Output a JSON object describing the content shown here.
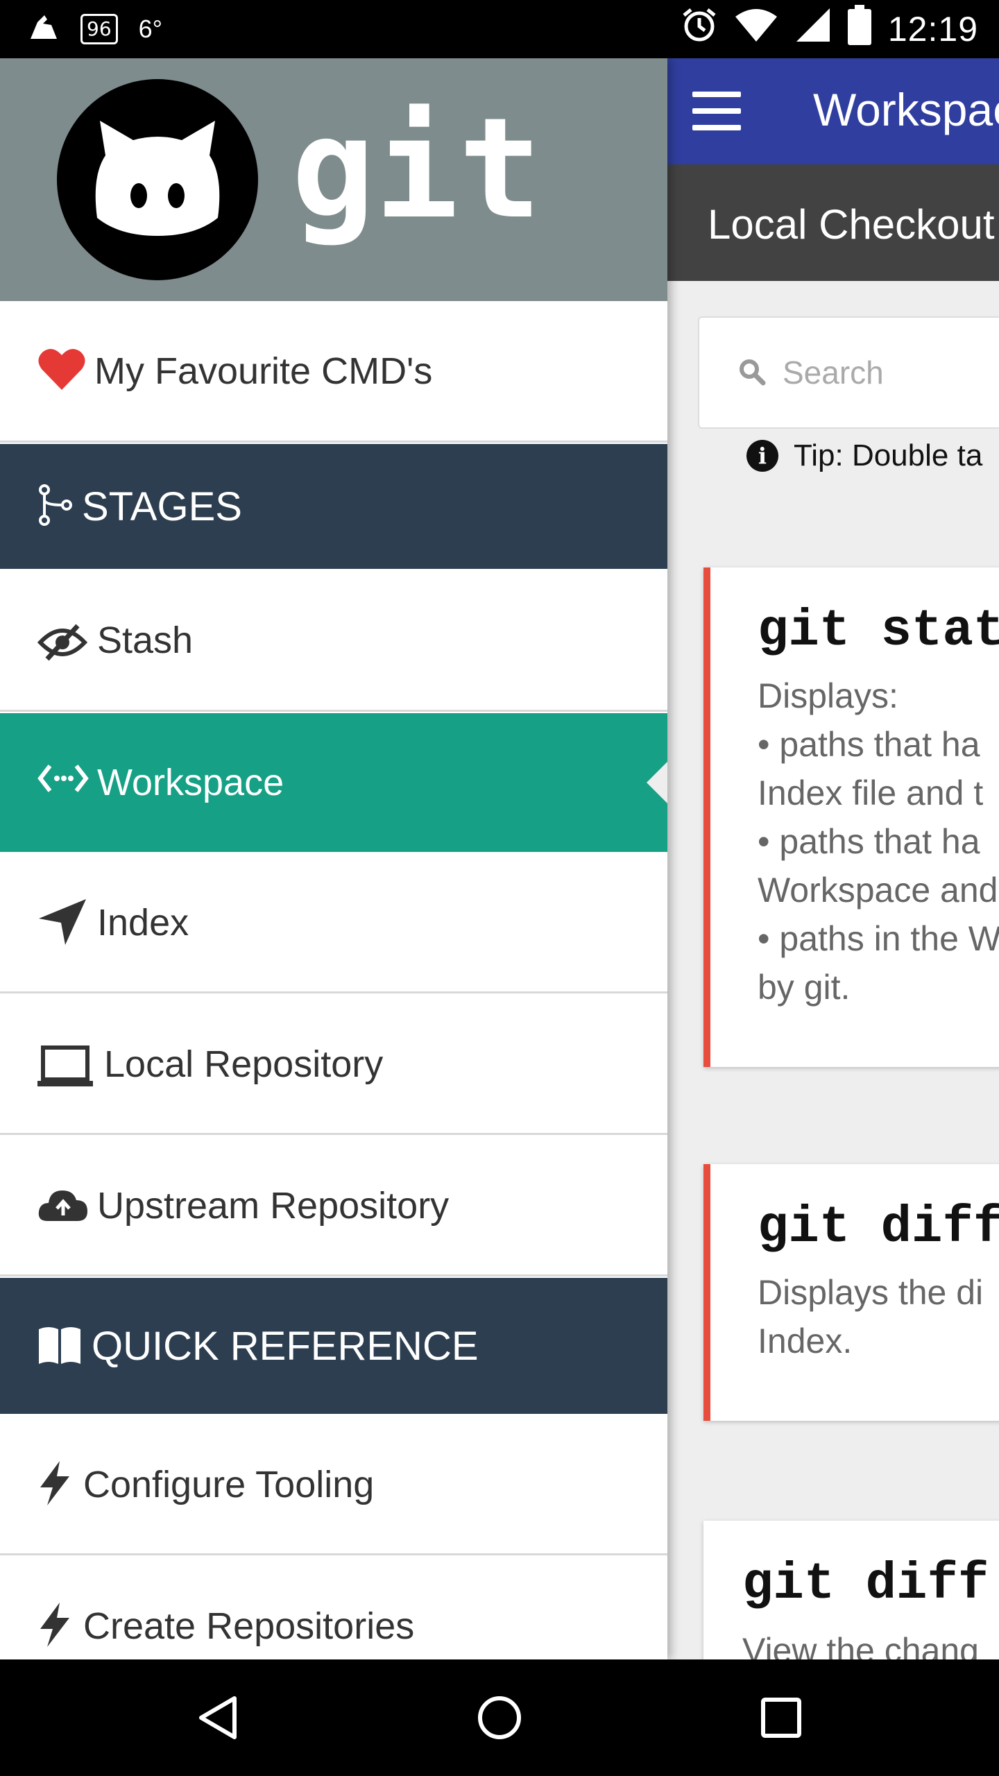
{
  "status_bar": {
    "badge": "96",
    "temperature": "6°",
    "battery_level": "96",
    "time": "12:19"
  },
  "header": {
    "logo_text": "git"
  },
  "drawer": {
    "favourites_label": "My Favourite CMD's",
    "stages_label": "STAGES",
    "items": [
      {
        "label": "Stash",
        "icon": "eye-slash-icon"
      },
      {
        "label": "Workspace",
        "icon": "code-arrows-icon",
        "active": true
      },
      {
        "label": "Index",
        "icon": "location-arrow-icon"
      },
      {
        "label": "Local Repository",
        "icon": "laptop-icon"
      },
      {
        "label": "Upstream Repository",
        "icon": "cloud-upload-icon"
      }
    ],
    "quick_reference_label": "QUICK REFERENCE",
    "reference_items": [
      {
        "label": "Configure Tooling",
        "icon": "bolt-icon"
      },
      {
        "label": "Create Repositories",
        "icon": "bolt-icon"
      }
    ]
  },
  "main": {
    "title": "Workspace",
    "subtitle": "Local Checkout",
    "search_placeholder": "Search",
    "tip": "Tip: Double ta",
    "cards": [
      {
        "command": "git status",
        "description": "Displays:\n• paths that ha\nIndex file and t\n• paths that ha\nWorkspace and\n• paths in the W\nby git."
      },
      {
        "command": "git diff",
        "description": "Displays the di\nIndex."
      },
      {
        "command": "git diff",
        "description": "View the chang"
      }
    ]
  },
  "colors": {
    "appbar": "#303f9f",
    "subbar": "#424242",
    "drawer_header": "#7f8c8d",
    "section": "#2c3e50",
    "active": "#16a085",
    "accent_border": "#e74c3c",
    "heart": "#e53935"
  }
}
